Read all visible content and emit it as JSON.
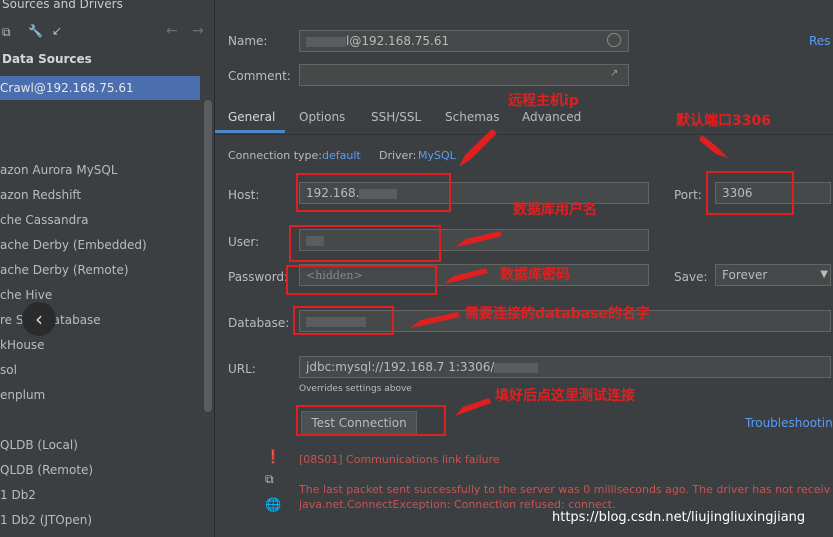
{
  "window": {
    "title": "Sources and Drivers"
  },
  "sidebar": {
    "section_title": "Data Sources",
    "selected_source": "Crawl@192.168.75.61",
    "drivers": [
      "azon Aurora MySQL",
      "azon Redshift",
      "che Cassandra",
      "ache Derby (Embedded)",
      "ache Derby (Remote)",
      "che Hive",
      "re SQL Database",
      "kHouse",
      "sol",
      "enplum",
      "QLDB (Local)",
      "QLDB (Remote)",
      "1 Db2",
      "1 Db2 (JTOpen)"
    ]
  },
  "form": {
    "name_label": "Name:",
    "name_value": "l@192.168.75.61",
    "reset_link": "Res",
    "comment_label": "Comment:",
    "connection_type_label": "Connection type:",
    "connection_type_value": "default",
    "driver_label": "Driver:",
    "driver_value": "MySQL",
    "host_label": "Host:",
    "host_value": "192.168.",
    "port_label": "Port:",
    "port_value": "3306",
    "user_label": "User:",
    "password_label": "Password:",
    "password_value": "<hidden>",
    "save_label": "Save:",
    "save_value": "Forever",
    "database_label": "Database:",
    "url_label": "URL:",
    "url_value": "jdbc:mysql://192.168.7  1:3306/",
    "overrides_note": "Overrides settings above",
    "test_button": "Test Connection",
    "troubleshooting_link": "Troubleshootin"
  },
  "tabs": [
    "General",
    "Options",
    "SSH/SSL",
    "Schemas",
    "Advanced"
  ],
  "errors": {
    "code": "[08S01] Communications link failure",
    "line1": "The last packet sent successfully to the server was 0 milliseconds ago. The driver has not received any",
    "line2": "java.net.ConnectException: Connection refused: connect."
  },
  "annotations": {
    "remote_host": "远程主机ip",
    "default_port": "默认端口3306",
    "db_user": "数据库用户名",
    "db_password": "数据库密码",
    "db_name": "需要连接的database的名字",
    "test_hint": "填好后点这里测试连接"
  },
  "watermark": "https://blog.csdn.net/liujingliuxingjiang",
  "colors": {
    "accent": "#4b6eaf",
    "link": "#589df6",
    "error": "#c75450",
    "annotation": "#e02020"
  }
}
